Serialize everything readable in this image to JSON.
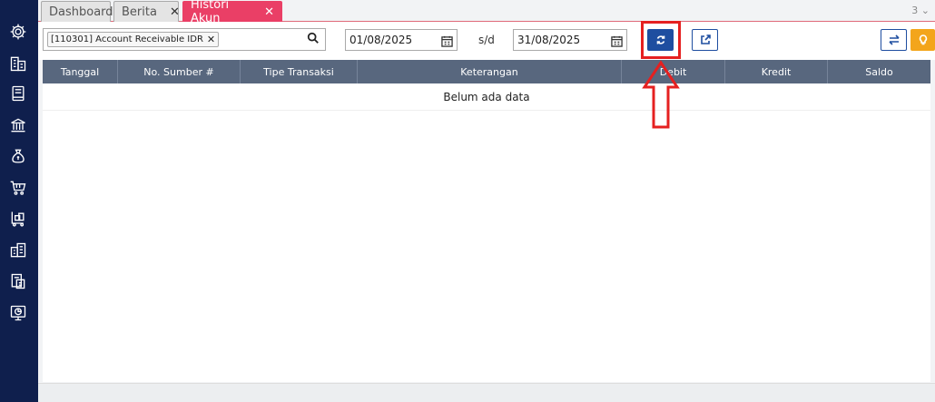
{
  "sidebar": {
    "icons": [
      "gear-icon",
      "building-icon",
      "book-icon",
      "bank-icon",
      "money-bag-icon",
      "cart-icon",
      "trolley-icon",
      "report-icon",
      "tax-document-icon",
      "monitor-chart-icon"
    ]
  },
  "tabs": [
    {
      "label": "Dashboard",
      "closable": false,
      "active": false
    },
    {
      "label": "Berita",
      "closable": true,
      "active": false
    },
    {
      "label": "Histori Akun",
      "closable": true,
      "active": true
    }
  ],
  "tab_count": "3",
  "toolbar": {
    "account_chip": "[110301] Account Receivable IDR",
    "date_from": "01/08/2025",
    "sd_label": "s/d",
    "date_to": "31/08/2025"
  },
  "table": {
    "columns": [
      "Tanggal",
      "No. Sumber #",
      "Tipe Transaksi",
      "Keterangan",
      "Debit",
      "Kredit",
      "Saldo"
    ],
    "empty_message": "Belum ada data"
  },
  "colors": {
    "sidebar": "#0f1f4d",
    "active_tab": "#ea3f66",
    "primary": "#1e4ea0",
    "warning": "#f3a51b",
    "header": "#58677e",
    "annotation": "#e52020"
  }
}
